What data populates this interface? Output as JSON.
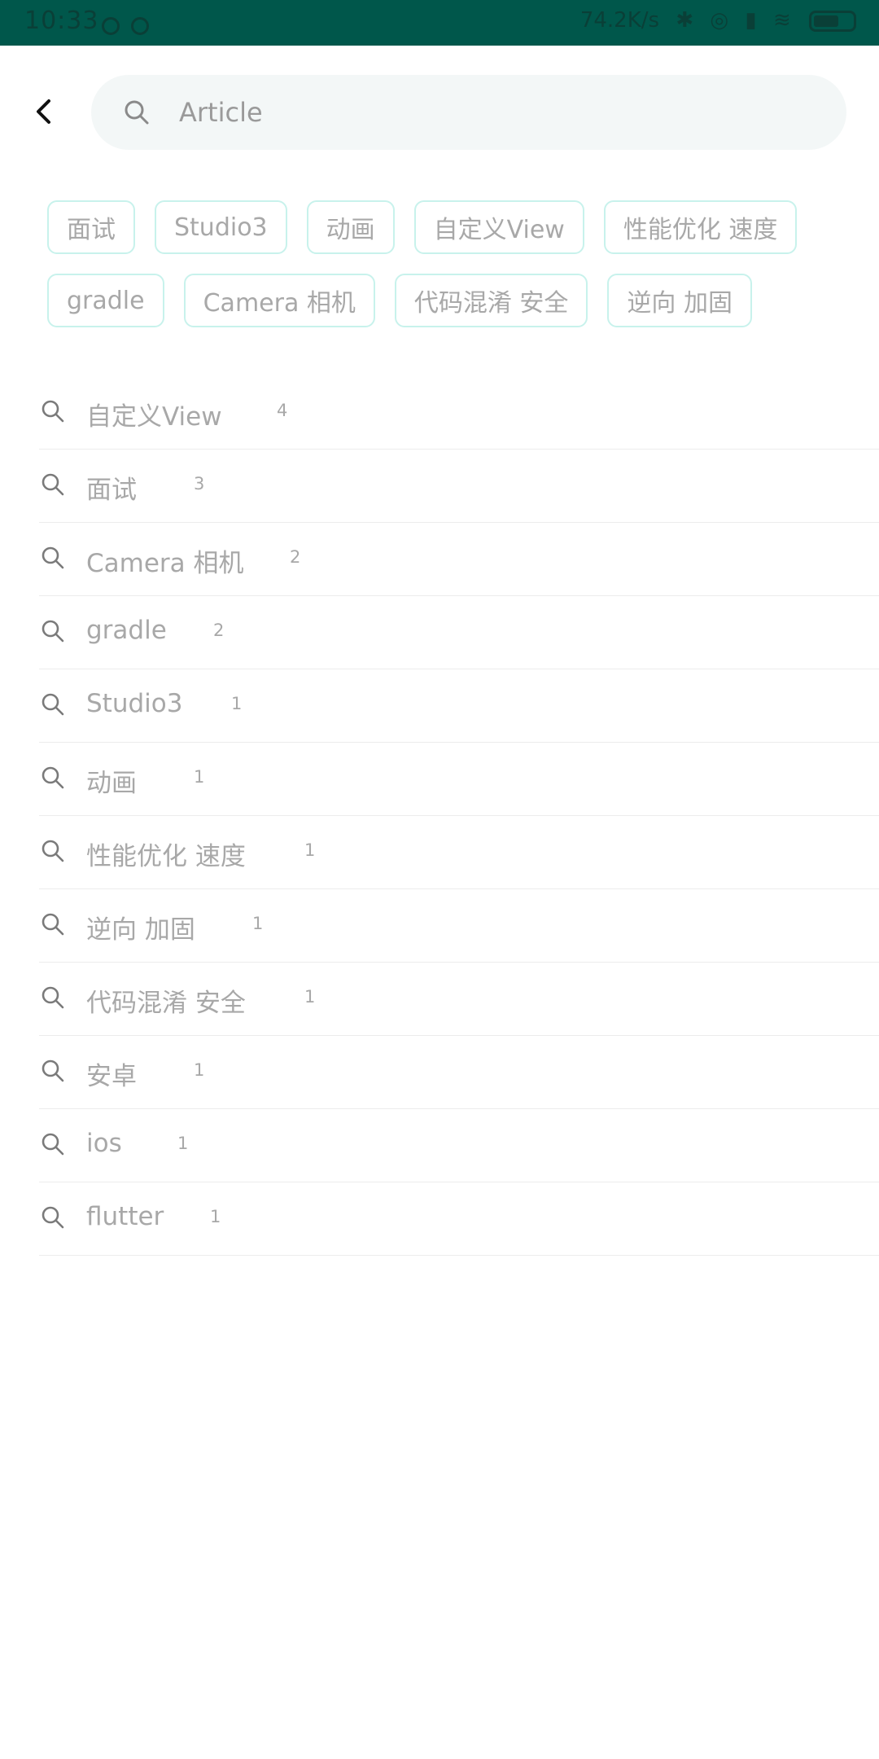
{
  "status_bar": {
    "time": "10:33",
    "right_text": "74.2K/s"
  },
  "search": {
    "placeholder": "Article",
    "value": ""
  },
  "tags_rows": [
    [
      "面试",
      "Studio3",
      "动画",
      "自定义View",
      "性能优化 速度"
    ],
    [
      "gradle",
      "Camera 相机",
      "代码混淆 安全",
      "逆向 加固"
    ]
  ],
  "history": [
    {
      "label": "自定义View",
      "count": "4"
    },
    {
      "label": "面试",
      "count": "3"
    },
    {
      "label": "Camera 相机",
      "count": "2"
    },
    {
      "label": "gradle",
      "count": "2"
    },
    {
      "label": "Studio3",
      "count": "1"
    },
    {
      "label": "动画",
      "count": "1"
    },
    {
      "label": "性能优化 速度",
      "count": "1"
    },
    {
      "label": "逆向 加固",
      "count": "1"
    },
    {
      "label": "代码混淆 安全",
      "count": "1"
    },
    {
      "label": "安卓",
      "count": "1"
    },
    {
      "label": "ios",
      "count": "1"
    },
    {
      "label": "flutter",
      "count": "1"
    }
  ],
  "colors": {
    "status_bar": "#00574b",
    "tag_border": "#c8f2ec",
    "search_bg": "#f3f7f7",
    "muted_text": "#a8a8a8"
  },
  "icons": {
    "back": "chevron-left-icon",
    "search": "search-icon"
  }
}
